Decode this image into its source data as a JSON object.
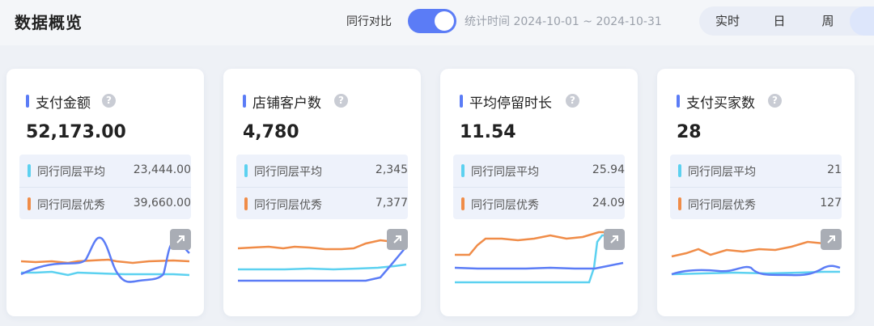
{
  "header": {
    "title": "数据概览",
    "compare_label": "同行对比",
    "compare_on": true,
    "date_range": "统计时间 2024-10-01 ~ 2024-10-31",
    "periods": [
      "实时",
      "日",
      "周"
    ]
  },
  "colors": {
    "accent": "#5b7cf6",
    "cyan": "#5cd1f0",
    "orange": "#f08c48"
  },
  "cards": [
    {
      "title": "支付金额",
      "value": "52,173.00",
      "avg_label": "同行同层平均",
      "avg_value": "23,444.00",
      "top_label": "同行同层优秀",
      "top_value": "39,660.00"
    },
    {
      "title": "店铺客户数",
      "value": "4,780",
      "avg_label": "同行同层平均",
      "avg_value": "2,345",
      "top_label": "同行同层优秀",
      "top_value": "7,377"
    },
    {
      "title": "平均停留时长",
      "value": "11.54",
      "avg_label": "同行同层平均",
      "avg_value": "25.94",
      "top_label": "同行同层优秀",
      "top_value": "24.09"
    },
    {
      "title": "支付买家数",
      "value": "28",
      "avg_label": "同行同层平均",
      "avg_value": "21",
      "top_label": "同行同层优秀",
      "top_value": "127"
    }
  ],
  "icons": {
    "help": "question-circle-icon",
    "expand": "expand-arrow-icon"
  }
}
